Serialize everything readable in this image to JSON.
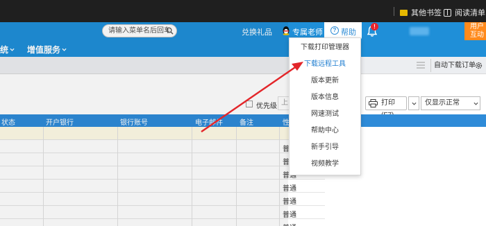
{
  "bookmarks": {
    "other_bookmarks": "其他书签",
    "reading_list": "阅读清单"
  },
  "header": {
    "search_placeholder": "请输入菜单名后回车",
    "exchange_gift": "兑换礼品",
    "exclusive_teacher": "专属老师",
    "help": "帮助",
    "notification_count": "!",
    "user_interact_line1": "用户",
    "user_interact_line2": "互动"
  },
  "nav": {
    "item_partial": "统",
    "value_added": "增值服务"
  },
  "toolbar": {
    "auto_download": "自动下载订单"
  },
  "filters": {
    "priority": "优先级",
    "up_partial": "上",
    "print": "打印(F7)",
    "status_select": "仅显示正常"
  },
  "table": {
    "headers": [
      "状态",
      "开户银行",
      "银行账号",
      "电子邮件",
      "备注",
      "性"
    ],
    "rows": [
      "",
      "普通",
      "普通",
      "普通",
      "普通",
      "普通",
      "普通",
      "普通"
    ]
  },
  "help_menu": {
    "items": [
      "下载打印管理器",
      "下载远程工具",
      "版本更新",
      "版本信息",
      "网速测试",
      "帮助中心",
      "新手引导",
      "视频教学"
    ]
  },
  "colors": {
    "header_blue": "#1f8fd8",
    "table_head_blue": "#2e8bd8",
    "accent_orange": "#ff8a1c",
    "arrow_red": "#e3262a"
  }
}
